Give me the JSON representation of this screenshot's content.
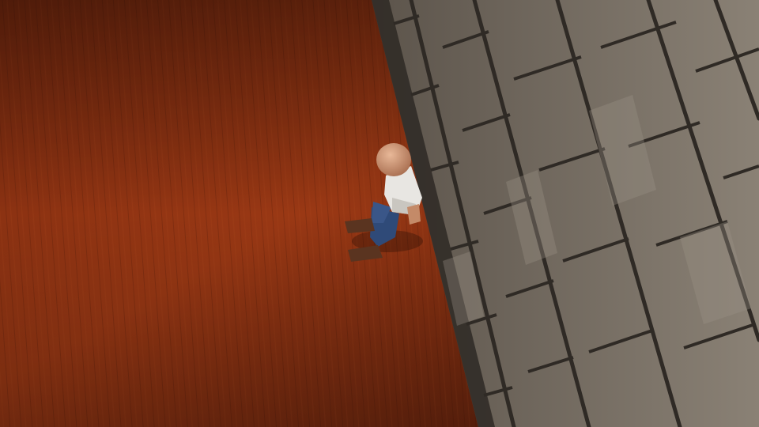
{
  "scene": {
    "floor": {
      "material": "wood",
      "color": "#8a2e10"
    },
    "wall": {
      "material": "stone-brick",
      "color": "#7d7468"
    },
    "character": {
      "description_icon": "bald-man-avatar"
    }
  }
}
